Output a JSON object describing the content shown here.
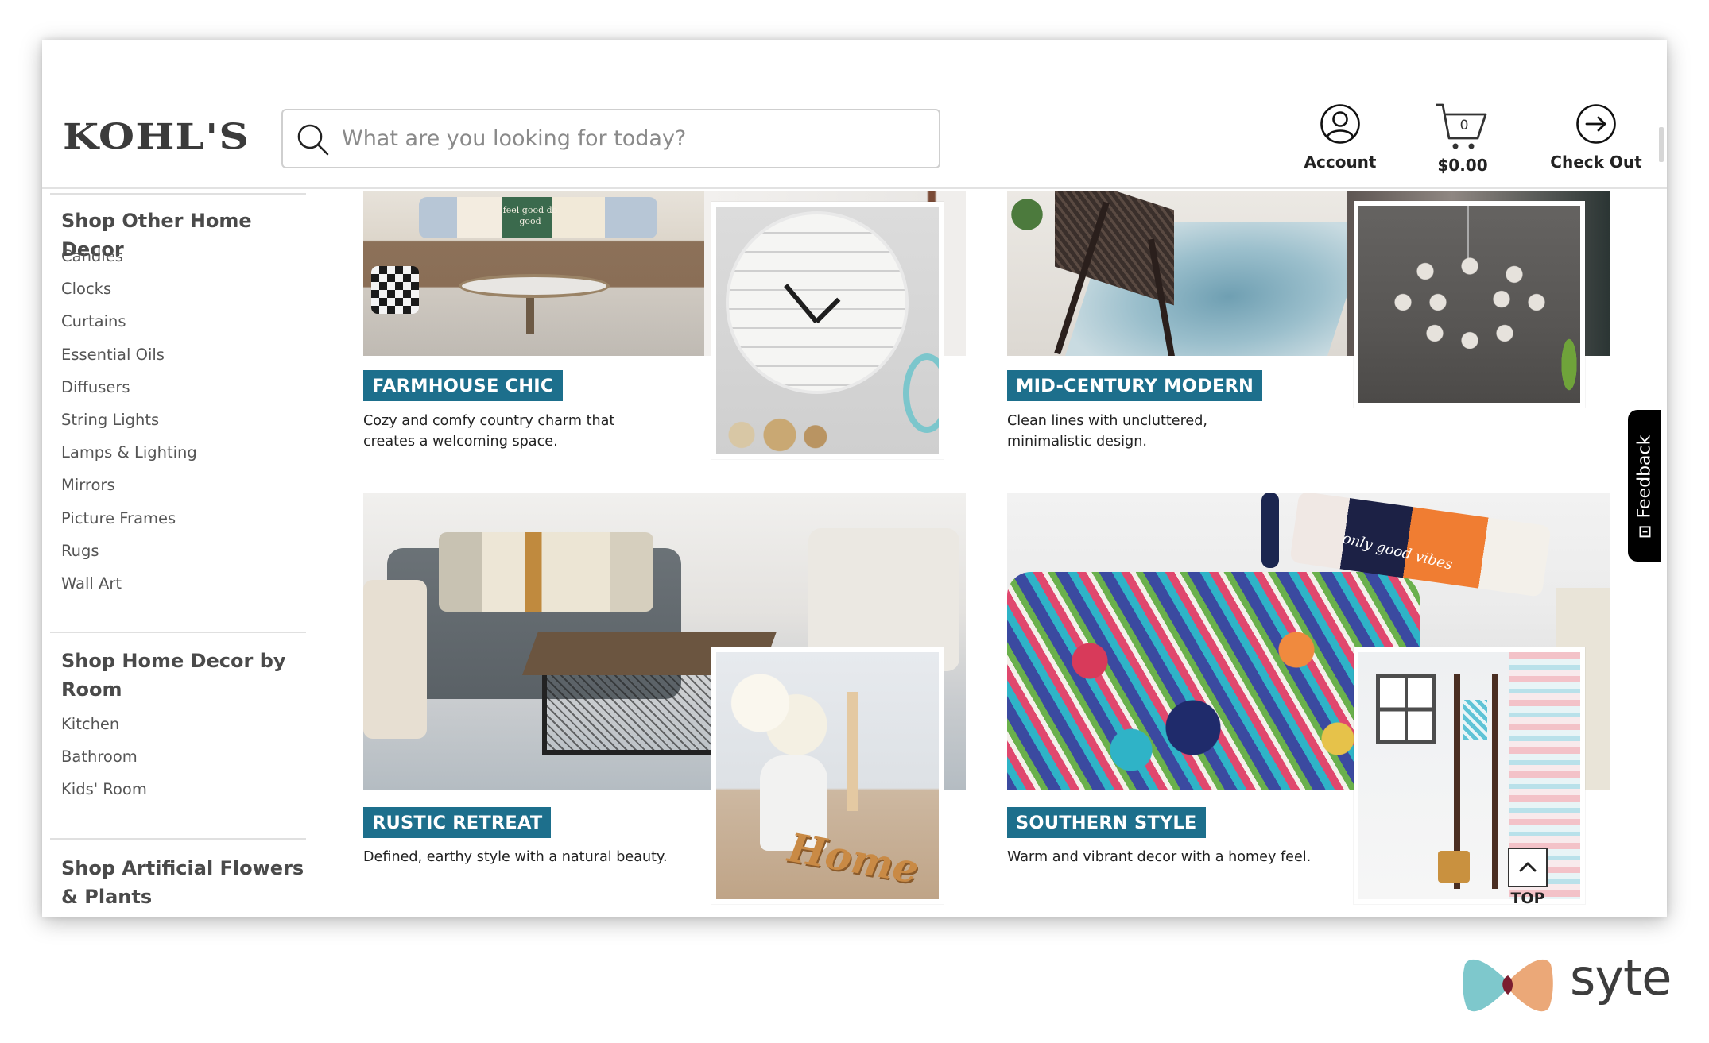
{
  "header": {
    "logo": "KOHL'S",
    "search": {
      "placeholder": "What are you looking for today?",
      "value": ""
    },
    "actions": {
      "account": "Account",
      "cart_count": "0",
      "cart_total": "$0.00",
      "checkout": "Check Out"
    }
  },
  "sidebar": {
    "sections": [
      {
        "heading": "Shop Other Home Decor",
        "items": [
          "Candles",
          "Clocks",
          "Curtains",
          "Essential Oils",
          "Diffusers",
          "String Lights",
          "Lamps & Lighting",
          "Mirrors",
          "Picture Frames",
          "Rugs",
          "Wall Art"
        ]
      },
      {
        "heading": "Shop Home Decor by Room",
        "items": [
          "Kitchen",
          "Bathroom",
          "Kids' Room"
        ]
      },
      {
        "heading": "Shop Artificial Flowers & Plants",
        "items": []
      }
    ]
  },
  "styles": [
    {
      "title": "FARMHOUSE CHIC",
      "description": "Cozy and comfy country charm that creates a welcoming space.",
      "image": "living-room-brown-sofa",
      "inset_image": "farmhouse-wall-clock",
      "pillow_text": "feel good do good"
    },
    {
      "title": "MID-CENTURY MODERN",
      "description": "Clean lines with uncluttered, minimalistic design.",
      "image": "woven-chair-blue-rug",
      "inset_image": "sputnik-chandelier"
    },
    {
      "title": "RUSTIC RETREAT",
      "description": "Defined, earthy style with a natural beauty.",
      "image": "gray-sofa-coffee-table",
      "inset_image": "white-flowers-home-sign",
      "sign_text": "Home"
    },
    {
      "title": "SOUTHERN STYLE",
      "description": "Warm and vibrant decor with a homey feel.",
      "image": "colorful-quilt-bed",
      "inset_image": "bathroom-ladder-curtain",
      "pillow_text": "only good vibes"
    }
  ],
  "feedback_tab": "Feedback",
  "back_to_top": "TOP",
  "watermark": "syte",
  "colors": {
    "tag_bg": "#1d6f8c",
    "text_dark": "#333333",
    "feedback_bg": "#000000",
    "syte_teal": "#7ec8cc",
    "syte_orange": "#eba878",
    "syte_maroon": "#7b1d30"
  }
}
